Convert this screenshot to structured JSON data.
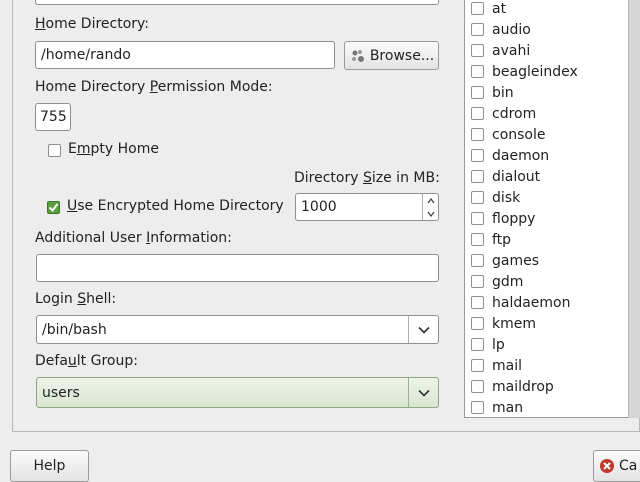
{
  "home_directory": {
    "label": "Home Directory:",
    "value": "/home/rando",
    "browse_label": "Browse..."
  },
  "permission_mode": {
    "label": "Home Directory Permission Mode:",
    "value": "755"
  },
  "empty_home": {
    "label": "Empty Home",
    "checked": false
  },
  "dir_size": {
    "label": "Directory Size in MB:",
    "value": "1000"
  },
  "encrypted_home": {
    "label": "Use Encrypted Home Directory",
    "checked": true
  },
  "additional_info": {
    "label": "Additional User Information:",
    "value": ""
  },
  "login_shell": {
    "label": "Login Shell:",
    "value": "/bin/bash"
  },
  "default_group": {
    "label": "Default Group:",
    "value": "users"
  },
  "groups": {
    "items": [
      "at",
      "audio",
      "avahi",
      "beagleindex",
      "bin",
      "cdrom",
      "console",
      "daemon",
      "dialout",
      "disk",
      "floppy",
      "ftp",
      "games",
      "gdm",
      "haldaemon",
      "kmem",
      "lp",
      "mail",
      "maildrop",
      "man"
    ]
  },
  "footer": {
    "help_label": "Help",
    "cancel_label": "Ca"
  },
  "colors": {
    "accent_green": "#5c9e3e",
    "cancel_red": "#c0392b"
  }
}
